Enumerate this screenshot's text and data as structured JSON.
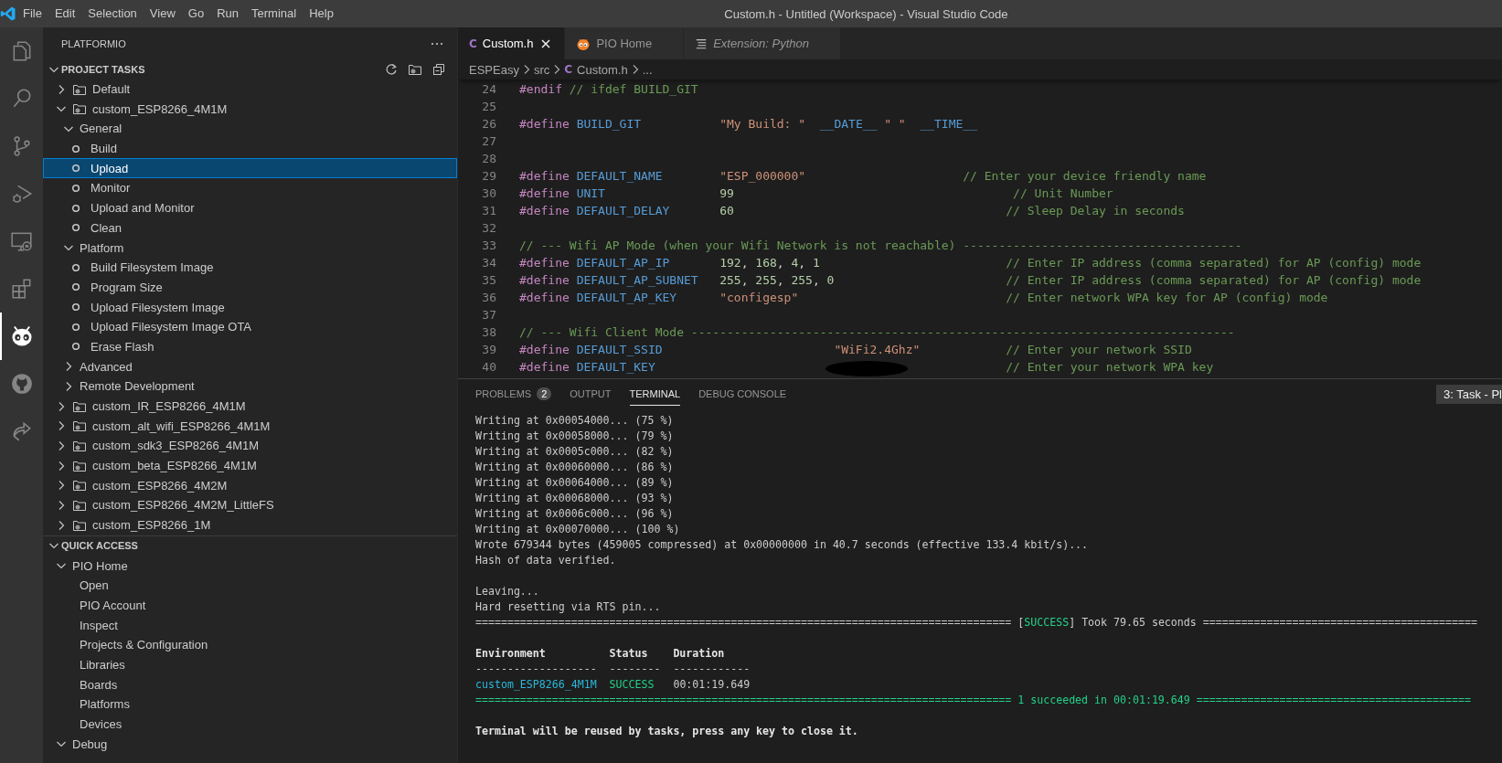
{
  "window": {
    "title": "Custom.h - Untitled (Workspace) - Visual Studio Code"
  },
  "menu": [
    "File",
    "Edit",
    "Selection",
    "View",
    "Go",
    "Run",
    "Terminal",
    "Help"
  ],
  "activity_bar": [
    {
      "kind": "files",
      "selected": false
    },
    {
      "kind": "search",
      "selected": false
    },
    {
      "kind": "branch",
      "selected": false
    },
    {
      "kind": "debug",
      "selected": false
    },
    {
      "kind": "remote",
      "selected": false
    },
    {
      "kind": "extensions",
      "selected": false
    },
    {
      "kind": "alien",
      "selected": true
    },
    {
      "kind": "cat",
      "selected": false
    },
    {
      "kind": "share",
      "selected": false
    }
  ],
  "sidebar": {
    "title": "PLATFORMIO",
    "sections": [
      {
        "label": "PROJECT TASKS",
        "expanded": true,
        "items": [
          {
            "kind": "env",
            "label": "Default",
            "expanded": false,
            "selected": false
          },
          {
            "kind": "env",
            "label": "custom_ESP8266_4M1M",
            "expanded": true,
            "selected": false,
            "children": [
              {
                "kind": "group",
                "label": "General",
                "expanded": true,
                "selected": false,
                "children": [
                  {
                    "kind": "task",
                    "label": "Build",
                    "selected": false
                  },
                  {
                    "kind": "task",
                    "label": "Upload",
                    "selected": true
                  },
                  {
                    "kind": "task",
                    "label": "Monitor",
                    "selected": false
                  },
                  {
                    "kind": "task",
                    "label": "Upload and Monitor",
                    "selected": false
                  },
                  {
                    "kind": "task",
                    "label": "Clean",
                    "selected": false
                  }
                ]
              },
              {
                "kind": "group",
                "label": "Platform",
                "expanded": true,
                "selected": false,
                "children": [
                  {
                    "kind": "task",
                    "label": "Build Filesystem Image",
                    "selected": false
                  },
                  {
                    "kind": "task",
                    "label": "Program Size",
                    "selected": false
                  },
                  {
                    "kind": "task",
                    "label": "Upload Filesystem Image",
                    "selected": false
                  },
                  {
                    "kind": "task",
                    "label": "Upload Filesystem Image OTA",
                    "selected": false
                  },
                  {
                    "kind": "task",
                    "label": "Erase Flash",
                    "selected": false
                  }
                ]
              },
              {
                "kind": "group",
                "label": "Advanced",
                "expanded": false,
                "selected": false
              },
              {
                "kind": "group",
                "label": "Remote Development",
                "expanded": false,
                "selected": false
              }
            ]
          },
          {
            "kind": "env",
            "label": "custom_IR_ESP8266_4M1M",
            "expanded": false,
            "selected": false
          },
          {
            "kind": "env",
            "label": "custom_alt_wifi_ESP8266_4M1M",
            "expanded": false,
            "selected": false
          },
          {
            "kind": "env",
            "label": "custom_sdk3_ESP8266_4M1M",
            "expanded": false,
            "selected": false
          },
          {
            "kind": "env",
            "label": "custom_beta_ESP8266_4M1M",
            "expanded": false,
            "selected": false
          },
          {
            "kind": "env",
            "label": "custom_ESP8266_4M2M",
            "expanded": false,
            "selected": false
          },
          {
            "kind": "env",
            "label": "custom_ESP8266_4M2M_LittleFS",
            "expanded": false,
            "selected": false
          },
          {
            "kind": "env",
            "label": "custom_ESP8266_1M",
            "expanded": false,
            "selected": false
          }
        ]
      },
      {
        "label": "QUICK ACCESS",
        "expanded": true,
        "items": [
          {
            "kind": "group",
            "label": "PIO Home",
            "expanded": true,
            "selected": false,
            "children": [
              {
                "kind": "link",
                "label": "Open",
                "selected": false
              },
              {
                "kind": "link",
                "label": "PIO Account",
                "selected": false
              },
              {
                "kind": "link",
                "label": "Inspect",
                "selected": false
              },
              {
                "kind": "link",
                "label": "Projects & Configuration",
                "selected": false
              },
              {
                "kind": "link",
                "label": "Libraries",
                "selected": false
              },
              {
                "kind": "link",
                "label": "Boards",
                "selected": false
              },
              {
                "kind": "link",
                "label": "Platforms",
                "selected": false
              },
              {
                "kind": "link",
                "label": "Devices",
                "selected": false
              }
            ]
          },
          {
            "kind": "group",
            "label": "Debug",
            "expanded": true,
            "selected": false
          }
        ]
      }
    ]
  },
  "editor": {
    "tabs": [
      {
        "kind": "c-file",
        "icon": "C",
        "label": "Custom.h",
        "selected": true
      },
      {
        "kind": "pio",
        "label": "PIO Home",
        "selected": false
      },
      {
        "kind": "preview",
        "label": "Extension: Python",
        "selected": false
      }
    ],
    "breadcrumb": [
      {
        "label": "ESPEasy"
      },
      {
        "label": "src"
      },
      {
        "icon": "C",
        "label": "Custom.h"
      },
      {
        "label": "..."
      }
    ],
    "lines": [
      {
        "number": "24",
        "tokens": [
          {
            "kind": "keyword",
            "text": "#endif "
          },
          {
            "kind": "comment",
            "text": "// ifdef BUILD_GIT"
          }
        ]
      },
      {
        "number": "25"
      },
      {
        "number": "26",
        "tokens": [
          {
            "kind": "keyword",
            "text": "#define "
          },
          {
            "kind": "macro",
            "text": "BUILD_GIT           "
          },
          {
            "kind": "string",
            "text": "\"My Build: \"  "
          },
          {
            "kind": "macro",
            "text": "__DATE__ "
          },
          {
            "kind": "string",
            "text": "\" \"  "
          },
          {
            "kind": "macro",
            "text": "__TIME__"
          }
        ]
      },
      {
        "number": "27"
      },
      {
        "number": "28"
      },
      {
        "number": "29",
        "tokens": [
          {
            "kind": "keyword",
            "text": "#define "
          },
          {
            "kind": "macro",
            "text": "DEFAULT_NAME        "
          },
          {
            "kind": "string",
            "text": "\"ESP_000000\"                      "
          },
          {
            "kind": "comment",
            "text": "// Enter your device friendly name"
          }
        ]
      },
      {
        "number": "30",
        "tokens": [
          {
            "kind": "keyword",
            "text": "#define "
          },
          {
            "kind": "macro",
            "text": "UNIT                "
          },
          {
            "kind": "number",
            "text": "99                                       "
          },
          {
            "kind": "comment",
            "text": "// Unit Number"
          }
        ]
      },
      {
        "number": "31",
        "tokens": [
          {
            "kind": "keyword",
            "text": "#define "
          },
          {
            "kind": "macro",
            "text": "DEFAULT_DELAY       "
          },
          {
            "kind": "number",
            "text": "60                                      "
          },
          {
            "kind": "comment",
            "text": "// Sleep Delay in seconds"
          }
        ]
      },
      {
        "number": "32"
      },
      {
        "number": "33",
        "tokens": [
          {
            "kind": "comment",
            "text": "// --- Wifi AP Mode (when your Wifi Network is not reachable) ---------------------------------------"
          }
        ]
      },
      {
        "number": "34",
        "tokens": [
          {
            "kind": "keyword",
            "text": "#define "
          },
          {
            "kind": "macro",
            "text": "DEFAULT_AP_IP       "
          },
          {
            "kind": "number",
            "text": "192"
          },
          {
            "kind": "plain",
            "text": ", "
          },
          {
            "kind": "number",
            "text": "168"
          },
          {
            "kind": "plain",
            "text": ", "
          },
          {
            "kind": "number",
            "text": "4"
          },
          {
            "kind": "plain",
            "text": ", "
          },
          {
            "kind": "number",
            "text": "1                          "
          },
          {
            "kind": "comment",
            "text": "// Enter IP address (comma separated) for AP (config) mode"
          }
        ]
      },
      {
        "number": "35",
        "tokens": [
          {
            "kind": "keyword",
            "text": "#define "
          },
          {
            "kind": "macro",
            "text": "DEFAULT_AP_SUBNET   "
          },
          {
            "kind": "number",
            "text": "255"
          },
          {
            "kind": "plain",
            "text": ", "
          },
          {
            "kind": "number",
            "text": "255"
          },
          {
            "kind": "plain",
            "text": ", "
          },
          {
            "kind": "number",
            "text": "255"
          },
          {
            "kind": "plain",
            "text": ", "
          },
          {
            "kind": "number",
            "text": "0                        "
          },
          {
            "kind": "comment",
            "text": "// Enter IP address (comma separated) for AP (config) mode"
          }
        ]
      },
      {
        "number": "36",
        "tokens": [
          {
            "kind": "keyword",
            "text": "#define "
          },
          {
            "kind": "macro",
            "text": "DEFAULT_AP_KEY      "
          },
          {
            "kind": "string",
            "text": "\"configesp\"                             "
          },
          {
            "kind": "comment",
            "text": "// Enter network WPA key for AP (config) mode"
          }
        ]
      },
      {
        "number": "37"
      },
      {
        "number": "38",
        "tokens": [
          {
            "kind": "comment",
            "text": "// --- Wifi Client Mode ----------------------------------------------------------------------------"
          }
        ]
      },
      {
        "number": "39",
        "tokens": [
          {
            "kind": "keyword",
            "text": "#define "
          },
          {
            "kind": "macro",
            "text": "DEFAULT_SSID                        "
          },
          {
            "kind": "string",
            "text": "\"WiFi2.4Ghz\"            "
          },
          {
            "kind": "comment",
            "text": "// Enter your network SSID"
          }
        ]
      },
      {
        "number": "40",
        "redacted": true,
        "tokens": [
          {
            "kind": "keyword",
            "text": "#define "
          },
          {
            "kind": "macro",
            "text": "DEFAULT_KEY                                                 "
          },
          {
            "kind": "comment",
            "text": "// Enter your network WPA key"
          }
        ]
      }
    ]
  },
  "panel": {
    "tabs": [
      {
        "label": "PROBLEMS",
        "badge": "2",
        "selected": false
      },
      {
        "label": "OUTPUT",
        "selected": false
      },
      {
        "label": "TERMINAL",
        "selected": true
      },
      {
        "label": "DEBUG CONSOLE",
        "selected": false
      }
    ],
    "terminal_selector": "3: Task - Pl",
    "lines": [
      {
        "kind": "text",
        "tokens": [
          {
            "kind": "plain",
            "text": "Writing at 0x00054000... (75 %)"
          }
        ]
      },
      {
        "kind": "text",
        "tokens": [
          {
            "kind": "plain",
            "text": "Writing at 0x00058000... (79 %)"
          }
        ]
      },
      {
        "kind": "text",
        "tokens": [
          {
            "kind": "plain",
            "text": "Writing at 0x0005c000... (82 %)"
          }
        ]
      },
      {
        "kind": "text",
        "tokens": [
          {
            "kind": "plain",
            "text": "Writing at 0x00060000... (86 %)"
          }
        ]
      },
      {
        "kind": "text",
        "tokens": [
          {
            "kind": "plain",
            "text": "Writing at 0x00064000... (89 %)"
          }
        ]
      },
      {
        "kind": "text",
        "tokens": [
          {
            "kind": "plain",
            "text": "Writing at 0x00068000... (93 %)"
          }
        ]
      },
      {
        "kind": "text",
        "tokens": [
          {
            "kind": "plain",
            "text": "Writing at 0x0006c000... (96 %)"
          }
        ]
      },
      {
        "kind": "text",
        "tokens": [
          {
            "kind": "plain",
            "text": "Writing at 0x00070000... (100 %)"
          }
        ]
      },
      {
        "kind": "text",
        "tokens": [
          {
            "kind": "plain",
            "text": "Wrote 679344 bytes (459005 compressed) at 0x00000000 in 40.7 seconds (effective 133.4 kbit/s)..."
          }
        ]
      },
      {
        "kind": "text",
        "tokens": [
          {
            "kind": "plain",
            "text": "Hash of data verified."
          }
        ]
      },
      {
        "kind": "blank"
      },
      {
        "kind": "text",
        "tokens": [
          {
            "kind": "plain",
            "text": "Leaving..."
          }
        ]
      },
      {
        "kind": "text",
        "tokens": [
          {
            "kind": "plain",
            "text": "Hard resetting via RTS pin..."
          }
        ]
      },
      {
        "kind": "text",
        "tokens": [
          {
            "kind": "plain",
            "text": "==================================================================================== ["
          },
          {
            "kind": "success",
            "text": "SUCCESS"
          },
          {
            "kind": "plain",
            "text": "] Took 79.65 seconds ==========================================="
          }
        ]
      },
      {
        "kind": "blank"
      },
      {
        "kind": "text",
        "tokens": [
          {
            "kind": "bold",
            "text": "Environment          Status    Duration"
          }
        ]
      },
      {
        "kind": "text",
        "tokens": [
          {
            "kind": "plain",
            "text": "-------------------  --------  ------------"
          }
        ]
      },
      {
        "kind": "text",
        "tokens": [
          {
            "kind": "link",
            "text": "custom_ESP8266_4M1M  "
          },
          {
            "kind": "success",
            "text": "SUCCESS"
          },
          {
            "kind": "plain",
            "text": "   00:01:19.649"
          }
        ]
      },
      {
        "kind": "text",
        "tokens": [
          {
            "kind": "success",
            "text": "==================================================================================== 1 succeeded in 00:01:19.649 ==========================================="
          }
        ]
      },
      {
        "kind": "blank"
      },
      {
        "kind": "text",
        "tokens": [
          {
            "kind": "bold",
            "text": "Terminal will be reused by tasks, press any key to close it."
          }
        ]
      }
    ]
  }
}
